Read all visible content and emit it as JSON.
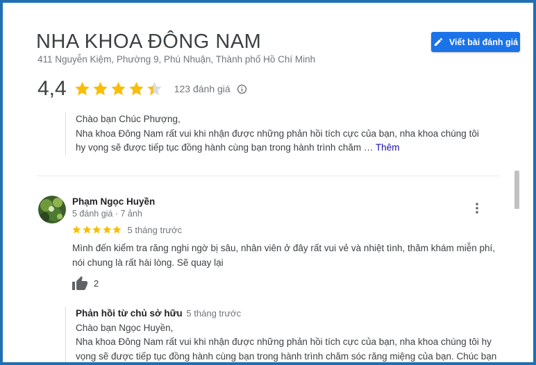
{
  "business": {
    "title": "NHA KHOA ĐÔNG NAM",
    "address": "411 Nguyễn Kiệm, Phường 9, Phú Nhuận, Thành phố Hồ Chí Minh",
    "rating": "4,4",
    "rating_value": 4.4,
    "review_count": "123 đánh giá",
    "write_review_label": "Viết bài đánh giá"
  },
  "colors": {
    "accent": "#1a73e8",
    "star": "#fbbc04",
    "star_empty": "#dadce0",
    "frame": "#1f6fb2"
  },
  "previous_reply": {
    "greeting": "Chào bạn Chúc Phượng,",
    "text": "Nha khoa Đông Nam rất vui khi nhận được những phản hồi tích cực của bạn, nha khoa chúng tôi hy vọng sẽ được tiếp tục đồng hành cùng bạn trong hành trình chăm …",
    "more_label": "Thêm"
  },
  "review": {
    "reviewer_name": "Phạm Ngọc Huyền",
    "reviewer_meta": "5 đánh giá · 7 ảnh",
    "stars": 5,
    "time": "5 tháng trước",
    "text": "Mình đến kiểm tra răng nghi ngờ bị sâu, nhân viên ở đây rất vui vẻ và nhiệt tình, thăm khám miễn phí, nói chung là rất hài lòng. Sẽ quay lại",
    "like_count": "2",
    "more_icon": "more-vert-icon",
    "like_icon": "thumb-up-icon"
  },
  "owner_reply": {
    "label": "Phản hồi từ chủ sở hữu",
    "time": "5 tháng trước",
    "greeting": "Chào bạn Ngọc Huyền,",
    "text": "Nha khoa Đông Nam rất vui khi nhận được những phản hồi tích cực của bạn, nha khoa chúng tôi hy vọng sẽ được tiếp tục đồng hành cùng bạn trong hành trình chăm sóc răng miệng của bạn. Chúc bạn luôn thật khỏe mạnh và nhiều niềm vui."
  }
}
